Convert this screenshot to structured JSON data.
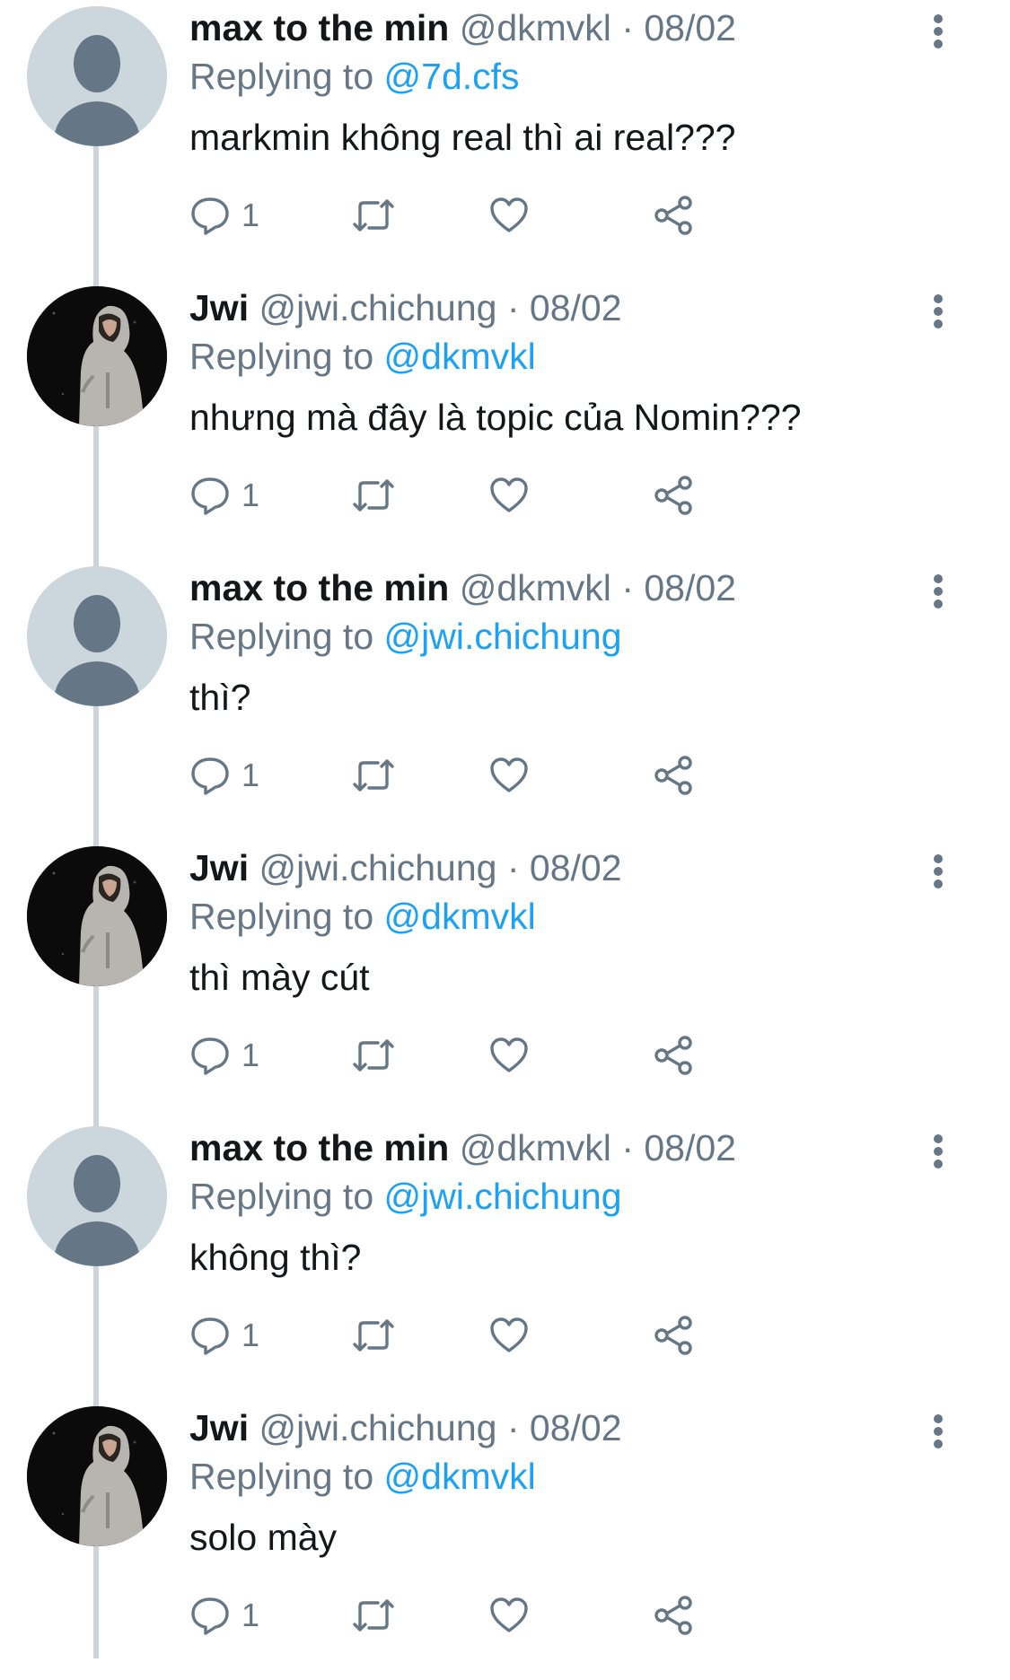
{
  "replying_label": "Replying to",
  "tweets": [
    {
      "name": "max to the min",
      "handle": "@dkmvkl",
      "sep": " · ",
      "date": "08/02",
      "reply_to": "@7d.cfs",
      "text": "markmin không real thì ai real???",
      "reply_count": "1",
      "avatar": "default-avatar"
    },
    {
      "name": "Jwi",
      "handle": "@jwi.chichung",
      "sep": " · ",
      "date": "08/02",
      "reply_to": "@dkmvkl",
      "text": "nhưng mà đây là topic của Nomin???",
      "reply_count": "1",
      "avatar": "photo-avatar"
    },
    {
      "name": "max to the min",
      "handle": "@dkmvkl",
      "sep": " · ",
      "date": "08/02",
      "reply_to": "@jwi.chichung",
      "text": "thì?",
      "reply_count": "1",
      "avatar": "default-avatar"
    },
    {
      "name": "Jwi",
      "handle": "@jwi.chichung",
      "sep": " · ",
      "date": "08/02",
      "reply_to": "@dkmvkl",
      "text": "thì mày cút",
      "reply_count": "1",
      "avatar": "photo-avatar"
    },
    {
      "name": "max to the min",
      "handle": "@dkmvkl",
      "sep": " · ",
      "date": "08/02",
      "reply_to": "@jwi.chichung",
      "text": "không thì?",
      "reply_count": "1",
      "avatar": "default-avatar"
    },
    {
      "name": "Jwi",
      "handle": "@jwi.chichung",
      "sep": " · ",
      "date": "08/02",
      "reply_to": "@dkmvkl",
      "text": "solo mày",
      "reply_count": "1",
      "avatar": "photo-avatar"
    }
  ],
  "icons": {
    "reply": "speech-bubble-icon",
    "retweet": "retweet-icon",
    "like": "heart-icon",
    "share": "share-icon",
    "more": "vertical-ellipsis-icon"
  },
  "colors": {
    "name": "#14171a",
    "meta": "#657786",
    "mention": "#1da1f2",
    "thread_line": "#cdd4da",
    "default_avatar_bg": "#ccd6dd",
    "default_avatar_fg": "#657786"
  }
}
